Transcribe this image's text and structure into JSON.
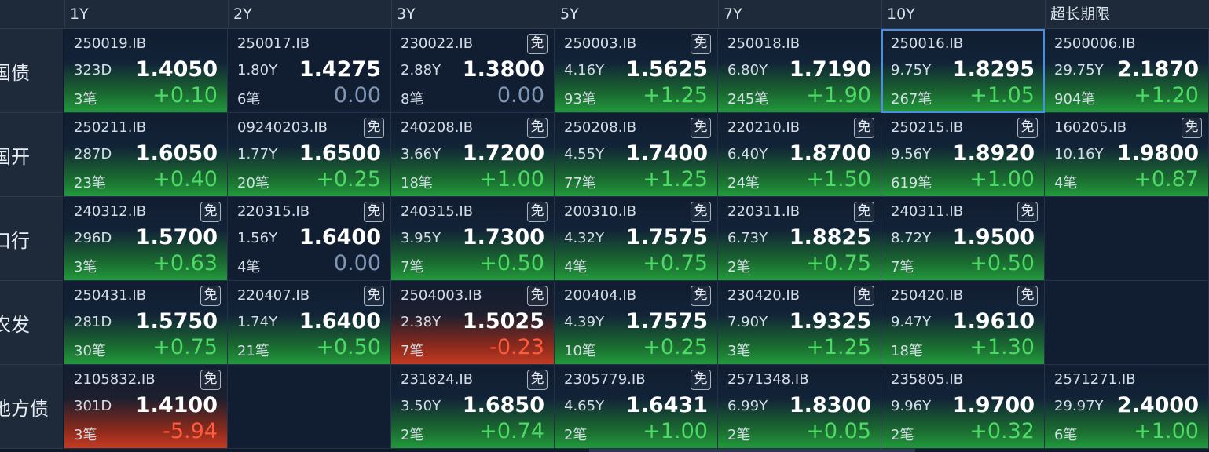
{
  "columns": [
    "1Y",
    "2Y",
    "3Y",
    "5Y",
    "7Y",
    "10Y",
    "超长期限"
  ],
  "rows": [
    {
      "label": "国债",
      "cells": [
        {
          "code": "250019.IB",
          "mian": "",
          "term": "323D",
          "yield": "1.4050",
          "count": "3笔",
          "change": "+0.10",
          "dir": "up"
        },
        {
          "code": "250017.IB",
          "mian": "",
          "term": "1.80Y",
          "yield": "1.4275",
          "count": "6笔",
          "change": "0.00",
          "dir": "flat"
        },
        {
          "code": "230022.IB",
          "mian": "免",
          "term": "2.88Y",
          "yield": "1.3800",
          "count": "8笔",
          "change": "0.00",
          "dir": "flat"
        },
        {
          "code": "250003.IB",
          "mian": "免",
          "term": "4.16Y",
          "yield": "1.5625",
          "count": "93笔",
          "change": "+1.25",
          "dir": "up"
        },
        {
          "code": "250018.IB",
          "mian": "",
          "term": "6.80Y",
          "yield": "1.7190",
          "count": "245笔",
          "change": "+1.90",
          "dir": "up"
        },
        {
          "code": "250016.IB",
          "mian": "",
          "term": "9.75Y",
          "yield": "1.8295",
          "count": "267笔",
          "change": "+1.05",
          "dir": "up",
          "selected": true
        },
        {
          "code": "2500006.IB",
          "mian": "",
          "term": "29.75Y",
          "yield": "2.1870",
          "count": "904笔",
          "change": "+1.20",
          "dir": "up"
        }
      ]
    },
    {
      "label": "国开",
      "cells": [
        {
          "code": "250211.IB",
          "mian": "",
          "term": "287D",
          "yield": "1.6050",
          "count": "23笔",
          "change": "+0.40",
          "dir": "up"
        },
        {
          "code": "09240203.IB",
          "mian": "免",
          "term": "1.77Y",
          "yield": "1.6500",
          "count": "20笔",
          "change": "+0.25",
          "dir": "up"
        },
        {
          "code": "240208.IB",
          "mian": "免",
          "term": "3.66Y",
          "yield": "1.7200",
          "count": "18笔",
          "change": "+1.00",
          "dir": "up"
        },
        {
          "code": "250208.IB",
          "mian": "免",
          "term": "4.55Y",
          "yield": "1.7400",
          "count": "77笔",
          "change": "+1.25",
          "dir": "up"
        },
        {
          "code": "220210.IB",
          "mian": "免",
          "term": "6.40Y",
          "yield": "1.8700",
          "count": "24笔",
          "change": "+1.50",
          "dir": "up"
        },
        {
          "code": "250215.IB",
          "mian": "免",
          "term": "9.56Y",
          "yield": "1.8920",
          "count": "619笔",
          "change": "+1.00",
          "dir": "up"
        },
        {
          "code": "160205.IB",
          "mian": "免",
          "term": "10.16Y",
          "yield": "1.9800",
          "count": "4笔",
          "change": "+0.87",
          "dir": "up"
        }
      ]
    },
    {
      "label": "口行",
      "cells": [
        {
          "code": "240312.IB",
          "mian": "免",
          "term": "296D",
          "yield": "1.5700",
          "count": "3笔",
          "change": "+0.63",
          "dir": "up"
        },
        {
          "code": "220315.IB",
          "mian": "免",
          "term": "1.56Y",
          "yield": "1.6400",
          "count": "4笔",
          "change": "0.00",
          "dir": "flat"
        },
        {
          "code": "240315.IB",
          "mian": "免",
          "term": "3.95Y",
          "yield": "1.7300",
          "count": "7笔",
          "change": "+0.50",
          "dir": "up"
        },
        {
          "code": "200310.IB",
          "mian": "免",
          "term": "4.32Y",
          "yield": "1.7575",
          "count": "4笔",
          "change": "+0.75",
          "dir": "up"
        },
        {
          "code": "220311.IB",
          "mian": "免",
          "term": "6.73Y",
          "yield": "1.8825",
          "count": "2笔",
          "change": "+0.75",
          "dir": "up"
        },
        {
          "code": "240311.IB",
          "mian": "免",
          "term": "8.72Y",
          "yield": "1.9500",
          "count": "7笔",
          "change": "+0.50",
          "dir": "up"
        },
        null
      ]
    },
    {
      "label": "农发",
      "cells": [
        {
          "code": "250431.IB",
          "mian": "免",
          "term": "281D",
          "yield": "1.5750",
          "count": "30笔",
          "change": "+0.75",
          "dir": "up"
        },
        {
          "code": "220407.IB",
          "mian": "免",
          "term": "1.74Y",
          "yield": "1.6400",
          "count": "21笔",
          "change": "+0.50",
          "dir": "up"
        },
        {
          "code": "2504003.IB",
          "mian": "免",
          "term": "2.38Y",
          "yield": "1.5025",
          "count": "7笔",
          "change": "-0.23",
          "dir": "down"
        },
        {
          "code": "200404.IB",
          "mian": "免",
          "term": "4.39Y",
          "yield": "1.7575",
          "count": "10笔",
          "change": "+0.25",
          "dir": "up"
        },
        {
          "code": "230420.IB",
          "mian": "免",
          "term": "7.90Y",
          "yield": "1.9325",
          "count": "3笔",
          "change": "+1.25",
          "dir": "up"
        },
        {
          "code": "250420.IB",
          "mian": "免",
          "term": "9.47Y",
          "yield": "1.9610",
          "count": "18笔",
          "change": "+1.30",
          "dir": "up"
        },
        null
      ]
    },
    {
      "label": "地方债",
      "cells": [
        {
          "code": "2105832.IB",
          "mian": "免",
          "term": "301D",
          "yield": "1.4100",
          "count": "3笔",
          "change": "-5.94",
          "dir": "down"
        },
        null,
        {
          "code": "231824.IB",
          "mian": "免",
          "term": "3.50Y",
          "yield": "1.6850",
          "count": "2笔",
          "change": "+0.74",
          "dir": "up"
        },
        {
          "code": "2305779.IB",
          "mian": "免",
          "term": "4.65Y",
          "yield": "1.6431",
          "count": "2笔",
          "change": "+1.00",
          "dir": "up"
        },
        {
          "code": "2571348.IB",
          "mian": "",
          "term": "6.99Y",
          "yield": "1.8300",
          "count": "2笔",
          "change": "+0.05",
          "dir": "up"
        },
        {
          "code": "235805.IB",
          "mian": "",
          "term": "9.96Y",
          "yield": "1.9700",
          "count": "2笔",
          "change": "+0.32",
          "dir": "up"
        },
        {
          "code": "2571271.IB",
          "mian": "",
          "term": "29.97Y",
          "yield": "2.4000",
          "count": "6笔",
          "change": "+1.00",
          "dir": "up"
        }
      ]
    }
  ],
  "colors": {
    "up": "#4cd964",
    "down": "#ff5a3c",
    "flat": "#7f97b4",
    "selected_border": "#4a90e2"
  }
}
